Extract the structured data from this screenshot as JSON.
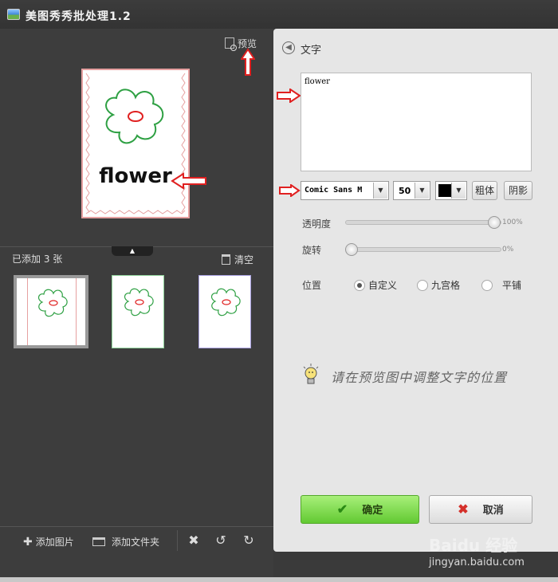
{
  "window": {
    "title": "美图秀秀批处理1.2"
  },
  "left": {
    "preview_label": "预览",
    "caption": "flower",
    "added_count": "已添加 3 张",
    "clear_label": "清空",
    "toolbar": {
      "add_image": "添加图片",
      "add_folder": "添加文件夹"
    }
  },
  "right": {
    "title": "文字",
    "text_value": "flower",
    "font": "Comic Sans M",
    "size": "50",
    "color": "#000000",
    "bold_label": "粗体",
    "shadow_label": "阴影",
    "opacity_label": "透明度",
    "opacity_value": "100%",
    "rotate_label": "旋转",
    "rotate_value": "0%",
    "position_label": "位置",
    "position_options": [
      "自定义",
      "九宫格",
      "平铺"
    ],
    "hint": "请在预览图中调整文字的位置",
    "confirm_label": "确定",
    "cancel_label": "取消"
  },
  "watermark": {
    "logo": "Baidu 经验",
    "url": "jingyan.baidu.com"
  },
  "colors": {
    "accent_green": "#62c932",
    "arrow_red": "#e02020",
    "flower_green": "#2ea043",
    "flower_red": "#e02020"
  }
}
